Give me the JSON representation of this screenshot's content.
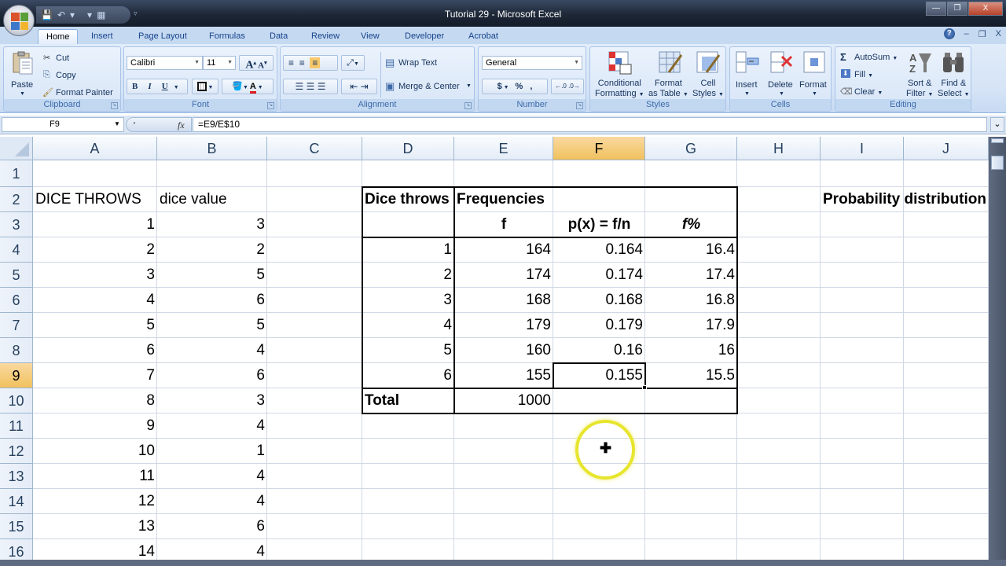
{
  "window": {
    "title": "Tutorial 29 - Microsoft Excel",
    "controls": {
      "minimize": "—",
      "restore": "❐",
      "close": "X"
    }
  },
  "quick_access": {
    "save": "💾",
    "undo": "↶",
    "undo_dd": "▾",
    "redo_dd": "▾",
    "form": "▦",
    "customize": "▿"
  },
  "tabs": [
    "Home",
    "Insert",
    "Page Layout",
    "Formulas",
    "Data",
    "Review",
    "View",
    "Developer",
    "Acrobat"
  ],
  "active_tab": "Home",
  "help": {
    "icon": "?",
    "min": "–",
    "restore": "❐",
    "close": "X"
  },
  "ribbon": {
    "clipboard": {
      "label": "Clipboard",
      "paste": "Paste",
      "cut": "Cut",
      "copy": "Copy",
      "format_painter": "Format Painter"
    },
    "font": {
      "label": "Font",
      "font_name": "Calibri",
      "font_size": "11",
      "grow": "A",
      "shrink": "A",
      "bold": "B",
      "italic": "I",
      "underline": "U",
      "font_color_accent": "#e21b1b"
    },
    "alignment": {
      "label": "Alignment",
      "wrap_text": "Wrap Text",
      "merge_center": "Merge & Center"
    },
    "number": {
      "label": "Number",
      "format": "General",
      "currency": "$",
      "percent": "%",
      "comma": ",",
      "inc_decimal": "←.0 .00",
      "dec_decimal": ".00 →.0"
    },
    "styles": {
      "label": "Styles",
      "conditional": [
        "Conditional",
        "Formatting"
      ],
      "format_table": [
        "Format",
        "as Table"
      ],
      "cell_styles": [
        "Cell",
        "Styles"
      ]
    },
    "cells": {
      "label": "Cells",
      "insert": "Insert",
      "delete": "Delete",
      "format": "Format"
    },
    "editing": {
      "label": "Editing",
      "autosum": "AutoSum",
      "fill": "Fill",
      "clear": "Clear",
      "sort_filter": [
        "Sort &",
        "Filter"
      ],
      "find_select": [
        "Find &",
        "Select"
      ]
    }
  },
  "formula_bar": {
    "name_box": "F9",
    "fx": "fx",
    "formula": "=E9/E$10"
  },
  "columns": [
    "A",
    "B",
    "C",
    "D",
    "E",
    "F",
    "G",
    "H",
    "I",
    "J"
  ],
  "selected_column": "F",
  "rows": [
    "1",
    "2",
    "3",
    "4",
    "5",
    "6",
    "7",
    "8",
    "9",
    "10",
    "11",
    "12",
    "13",
    "14",
    "15",
    "16"
  ],
  "selected_row": "9",
  "sheet": {
    "A2": "DICE THROWS",
    "B2": "dice value",
    "throws": [
      {
        "n": "1",
        "v": "3"
      },
      {
        "n": "2",
        "v": "2"
      },
      {
        "n": "3",
        "v": "5"
      },
      {
        "n": "4",
        "v": "6"
      },
      {
        "n": "5",
        "v": "5"
      },
      {
        "n": "6",
        "v": "4"
      },
      {
        "n": "7",
        "v": "6"
      },
      {
        "n": "8",
        "v": "3"
      },
      {
        "n": "9",
        "v": "4"
      },
      {
        "n": "10",
        "v": "1"
      },
      {
        "n": "11",
        "v": "4"
      },
      {
        "n": "12",
        "v": "4"
      },
      {
        "n": "13",
        "v": "6"
      },
      {
        "n": "14",
        "v": "4"
      }
    ],
    "freq_table": {
      "header_d": "Dice throws",
      "header_e": "Frequencies",
      "sub_e": "f",
      "sub_f": "p(x) = f/n",
      "sub_g": "f%",
      "rows": [
        {
          "d": "1",
          "e": "164",
          "f": "0.164",
          "g": "16.4"
        },
        {
          "d": "2",
          "e": "174",
          "f": "0.174",
          "g": "17.4"
        },
        {
          "d": "3",
          "e": "168",
          "f": "0.168",
          "g": "16.8"
        },
        {
          "d": "4",
          "e": "179",
          "f": "0.179",
          "g": "17.9"
        },
        {
          "d": "5",
          "e": "160",
          "f": "0.16",
          "g": "16"
        },
        {
          "d": "6",
          "e": "155",
          "f": "0.155",
          "g": "15.5"
        }
      ],
      "total_label": "Total",
      "total_value": "1000"
    },
    "I2": "Probability distribution"
  }
}
